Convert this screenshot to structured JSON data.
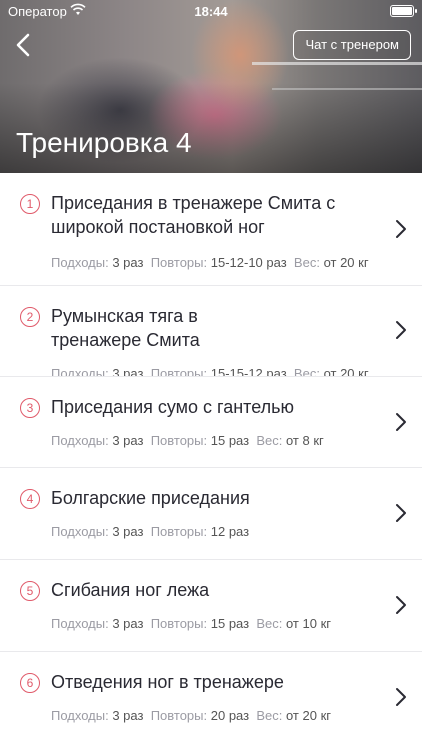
{
  "status": {
    "carrier": "Оператор",
    "time": "18:44"
  },
  "header": {
    "chat_label": "Чат с тренером",
    "title": "Тренировка 4"
  },
  "labels": {
    "sets": "Подходы:",
    "reps": "Повторы:",
    "weight": "Вес:"
  },
  "exercises": [
    {
      "num": "1",
      "name": "Приседания в тренажере Смита с широкой постановкой ног",
      "sets": "3 раз",
      "reps": "15-12-10 раз",
      "weight": "от 20  кг"
    },
    {
      "num": "2",
      "name": "Румынская тяга в тренажере Смита",
      "sets": "3 раз",
      "reps": "15-15-12 раз",
      "weight": "от 20  кг"
    },
    {
      "num": "3",
      "name": "Приседания сумо с гантелью",
      "sets": "3 раз",
      "reps": "15 раз",
      "weight": "от 8 кг"
    },
    {
      "num": "4",
      "name": "Болгарские приседания",
      "sets": "3 раз",
      "reps": "12 раз",
      "weight": ""
    },
    {
      "num": "5",
      "name": "Сгибания ног лежа",
      "sets": "3 раз",
      "reps": "15 раз",
      "weight": "от 10  кг"
    },
    {
      "num": "6",
      "name": "Отведения ног в тренажере",
      "sets": "3 раз",
      "reps": "20 раз",
      "weight": "от 20  кг"
    }
  ]
}
